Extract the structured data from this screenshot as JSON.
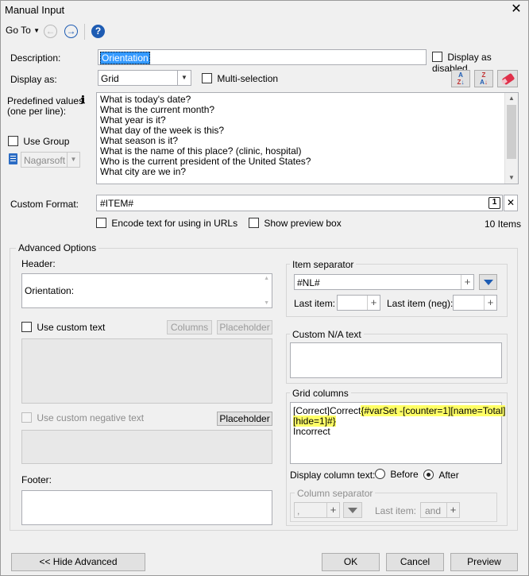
{
  "window": {
    "title": "Manual Input",
    "close": "✕"
  },
  "toolbar": {
    "goto_label": "Go To",
    "help": "?"
  },
  "form": {
    "description_label": "Description:",
    "description_value": "Orientation",
    "display_disabled_label": "Display as disabled",
    "display_as_label": "Display as:",
    "display_as_value": "Grid",
    "multi_selection_label": "Multi-selection",
    "predefined_label_1": "Predefined values",
    "predefined_label_2": "(one per line):",
    "predefined_values": [
      "What is today's date?",
      "What is the current month?",
      "What year is it?",
      "What day of the week is this?",
      "What season is it?",
      "What is the name of this place? (clinic, hospital)",
      "Who is the current president of the United States?",
      "What city are we in?"
    ],
    "use_group_label": "Use Group",
    "group_value": "Nagarsoft",
    "custom_format_label": "Custom Format:",
    "custom_format_value": "#ITEM#",
    "format_badge": "1",
    "encode_label": "Encode text for using in URLs",
    "preview_box_label": "Show preview box",
    "items_count": "10 Items"
  },
  "advanced": {
    "title": "Advanced Options",
    "header_label": "Header:",
    "header_value": "Orientation:",
    "use_custom_text_label": "Use custom text",
    "columns_btn": "Columns",
    "placeholder_btn": "Placeholder",
    "use_custom_negative_label": "Use custom negative text",
    "placeholder_btn_2": "Placeholder",
    "footer_label": "Footer:",
    "item_separator_title": "Item separator",
    "item_separator_value": "#NL#",
    "last_item_label": "Last item:",
    "last_item_neg_label": "Last item (neg):",
    "custom_na_title": "Custom N/A text",
    "grid_columns_title": "Grid columns",
    "grid_line1_a": "[Correct]Correct",
    "grid_line1_b": "{#varSet -[counter=1][name=Total]",
    "grid_line2": "[hide=1]#}",
    "grid_line3": "Incorrect",
    "display_column_text_label": "Display column text:",
    "before_label": "Before",
    "after_label": "After",
    "column_separator_title": "Column separator",
    "column_separator_value": ",",
    "col_last_item_label": "Last item:",
    "col_last_item_value": "and"
  },
  "footer": {
    "hide_advanced": "<< Hide Advanced",
    "ok": "OK",
    "cancel": "Cancel",
    "preview": "Preview"
  }
}
